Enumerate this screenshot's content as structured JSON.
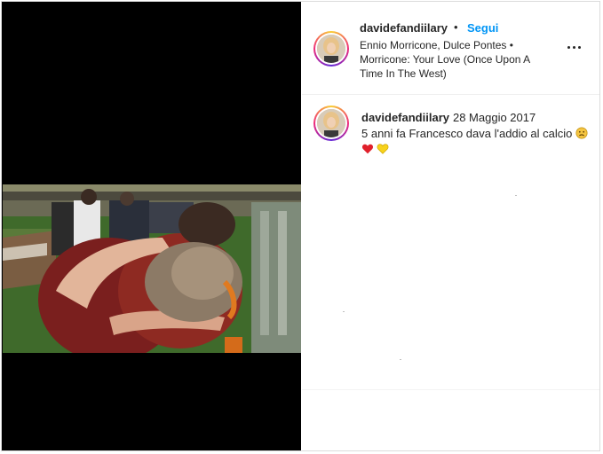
{
  "post": {
    "username": "davidefandiilary",
    "separator": "•",
    "follow_label": "Segui",
    "music": "Ennio Morricone, Dulce Pontes • Morricone: Your Love (Once Upon A Time In The West)",
    "more_icon": "more-horizontal-icon"
  },
  "comment": {
    "username": "davidefandiilary",
    "date": "28 Maggio 2017",
    "text": "5 anni fa Francesco dava l'addio al calcio",
    "emojis": [
      "sad-face-emoji",
      "red-heart-emoji",
      "yellow-heart-emoji"
    ]
  },
  "colors": {
    "follow": "#0095f6",
    "text": "#262626",
    "border": "#dbdbdb",
    "media_bg": "#000000"
  }
}
